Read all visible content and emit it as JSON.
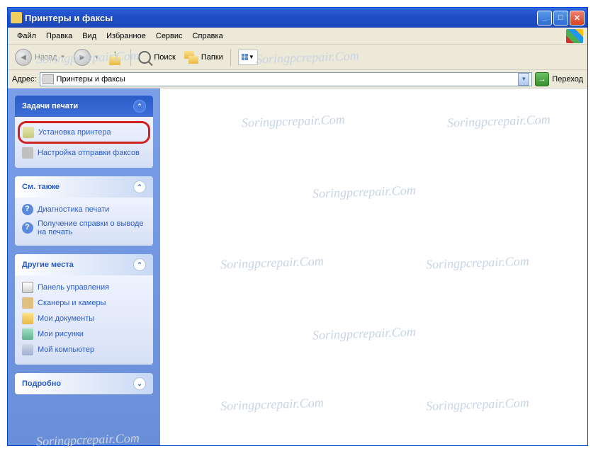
{
  "title": "Принтеры и факсы",
  "menubar": {
    "file": "Файл",
    "edit": "Правка",
    "view": "Вид",
    "favorites": "Избранное",
    "tools": "Сервис",
    "help": "Справка"
  },
  "toolbar": {
    "back": "Назад",
    "search": "Поиск",
    "folders": "Папки"
  },
  "addressbar": {
    "label": "Адрес:",
    "value": "Принтеры и факсы",
    "go": "Переход"
  },
  "panels": {
    "print_tasks": {
      "title": "Задачи печати",
      "install_printer": "Установка принтера",
      "fax_setup": "Настройка отправки факсов"
    },
    "see_also": {
      "title": "См. также",
      "diagnostics": "Диагностика печати",
      "help": "Получение справки о выводе на печать"
    },
    "other_places": {
      "title": "Другие места",
      "control_panel": "Панель управления",
      "scanners": "Сканеры и камеры",
      "my_docs": "Мои документы",
      "my_pics": "Мои рисунки",
      "my_computer": "Мой компьютер"
    },
    "details": {
      "title": "Подробно"
    }
  },
  "watermark": "Soringpcrepair.Com"
}
